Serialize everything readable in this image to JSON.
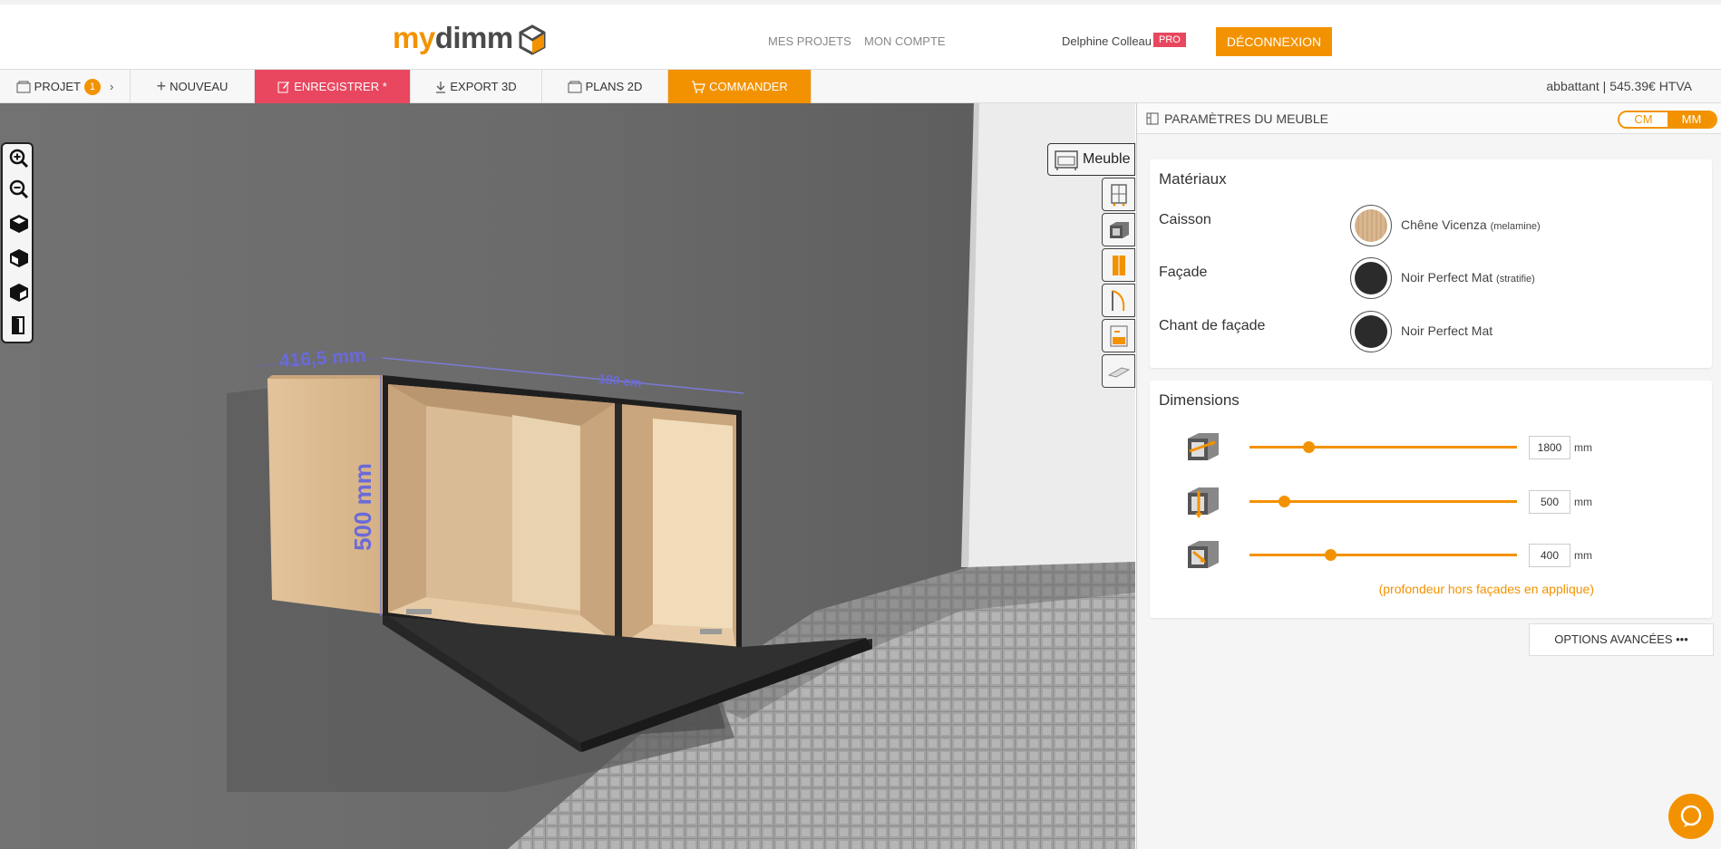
{
  "header": {
    "logo_my": "my",
    "logo_dimm": "dimm",
    "links": {
      "projects": "MES PROJETS",
      "account": "MON COMPTE"
    },
    "user_name": "Delphine Colleau",
    "pro_badge": "PRO",
    "logout": "DÉCONNEXION"
  },
  "toolbar": {
    "project": "PROJET",
    "project_count": "1",
    "new": "NOUVEAU",
    "save": "ENREGISTRER *",
    "export": "EXPORT 3D",
    "plans": "PLANS 2D",
    "order": "COMMANDER",
    "price": "abbattant | 545.39€ HTVA"
  },
  "viewport": {
    "meuble_tab": "Meuble",
    "dim_depth": "416,5 mm",
    "dim_width": "180 cm",
    "dim_height": "500 mm"
  },
  "panel": {
    "title": "PARAMÈTRES DU MEUBLE",
    "unit_cm": "CM",
    "unit_mm": "MM",
    "materials": {
      "title": "Matériaux",
      "rows": [
        {
          "label": "Caisson",
          "name": "Chêne Vicenza",
          "note": "(melamine)",
          "color": "#d8b791"
        },
        {
          "label": "Façade",
          "name": "Noir Perfect Mat",
          "note": "(stratifie)",
          "color": "#2b2b2b"
        },
        {
          "label": "Chant de façade",
          "name": "Noir Perfect Mat",
          "note": "",
          "color": "#2b2b2b"
        }
      ]
    },
    "dimensions": {
      "title": "Dimensions",
      "rows": [
        {
          "icon": "width-icon",
          "value": "1800",
          "unit": "mm",
          "fill": 0.22
        },
        {
          "icon": "height-icon",
          "value": "500",
          "unit": "mm",
          "fill": 0.13
        },
        {
          "icon": "depth-icon",
          "value": "400",
          "unit": "mm",
          "fill": 0.3
        }
      ],
      "note": "(profondeur hors façades en applique)"
    },
    "advanced": "OPTIONS AVANCÉES •••"
  },
  "colors": {
    "accent": "#f39200",
    "save": "#e8475f",
    "measure": "#6a6ad8"
  }
}
